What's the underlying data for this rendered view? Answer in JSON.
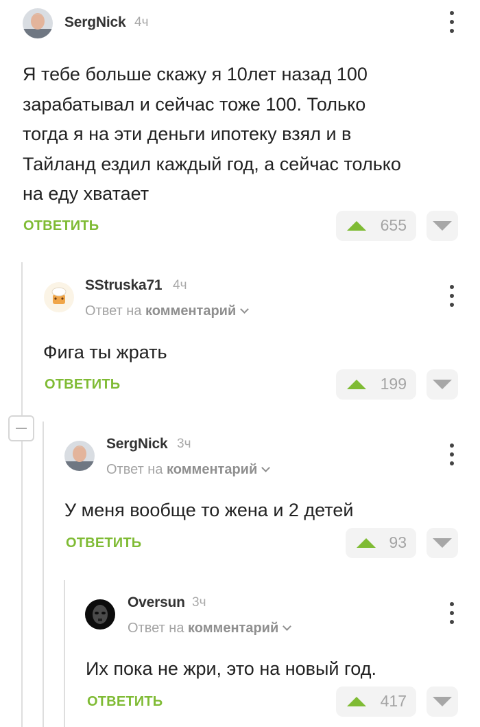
{
  "comments": [
    {
      "author": "SergNick",
      "time": "4ч",
      "text_lines": [
        "Я тебе больше скажу я 10лет назад 100",
        "зарабатывал и сейчас тоже 100. Только",
        "тогда я на эти деньги ипотеку взял и в",
        "Тайланд ездил каждый год, а сейчас только",
        "на еду хватает"
      ],
      "reply_label": "ОТВЕТИТЬ",
      "votes": "655"
    },
    {
      "author": "SStruska71",
      "time": "4ч",
      "reply_prefix": "Ответ на",
      "reply_target": "комментарий",
      "text_lines": [
        "Фига ты жрать"
      ],
      "reply_label": "ОТВЕТИТЬ",
      "votes": "199"
    },
    {
      "author": "SergNick",
      "time": "3ч",
      "reply_prefix": "Ответ на",
      "reply_target": "комментарий",
      "text_lines": [
        "У меня вообще то жена и 2 детей"
      ],
      "reply_label": "ОТВЕТИТЬ",
      "votes": "93"
    },
    {
      "author": "Oversun",
      "time": "3ч",
      "reply_prefix": "Ответ на",
      "reply_target": "комментарий",
      "text_lines": [
        "Их пока не жри, это на новый год."
      ],
      "reply_label": "ОТВЕТИТЬ",
      "votes": "417"
    }
  ],
  "colors": {
    "accent_green": "#7fbb34",
    "muted_gray": "#a3a3a3",
    "thread_line": "#dedede"
  },
  "icons": [
    "more-vertical-icon",
    "upvote-triangle-icon",
    "downvote-triangle-icon",
    "chevron-down-icon",
    "collapse-minus-icon"
  ]
}
